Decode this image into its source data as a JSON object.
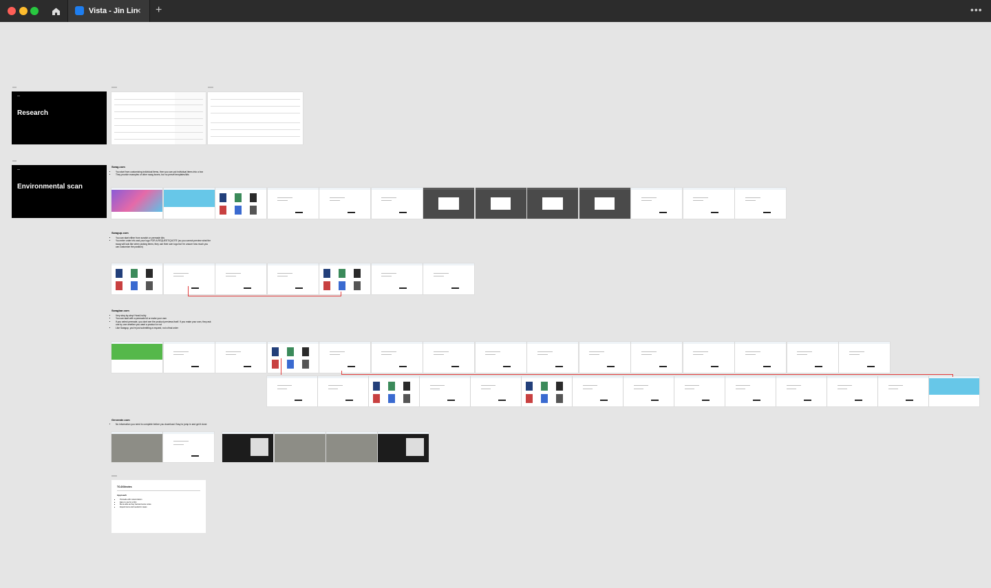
{
  "window": {
    "tab_title": "Vista - Jin Lin",
    "tab_close": "×",
    "new_tab": "+",
    "more": "•••",
    "traffic_lights": {
      "close": "#ff5f57",
      "minimize": "#febc2e",
      "zoom": "#28c840"
    },
    "accent": "#1e7ef0"
  },
  "canvas": {
    "background": "#e5e5e5",
    "sections": [
      {
        "label": "Research"
      },
      {
        "label": "Environmental scan"
      }
    ],
    "swag": {
      "heading": "Swag.com",
      "notes": [
        "You start from customizing individual items, then you can put individual items into a box",
        "They provide examples of other swag boxes, but no preset templates/kits"
      ]
    },
    "swagup": {
      "heading": "Swagup.com",
      "notes": [
        "You can start either from scratch or premade kits",
        "You enter order info and your logo FOR A REQUEST/QUOTE (so you cannot preview what the swag will look like when picking items; they use their own logo but i'm unsure how much you can customize the position)"
      ]
    },
    "swagbar": {
      "heading": "Swagbar.com",
      "notes": [
        "Very step-by-step/ Hand-holdy",
        "You can start with a premade kit or make your own",
        "If you select premade, you dont see the product previews itself. If you make your own, they ask one by one whether you want a product or not",
        "Like Swagup, you're just submitting a request, not a final order"
      ]
    },
    "generate": {
      "heading": "Generate.com",
      "notes": [
        "No information you need to complete before you download. Easy to jump in and get it done"
      ]
    },
    "summary": {
      "title": "TO-DO/notes",
      "subtitle": "Approach",
      "items": [
        "Premade with customization",
        "Easy to use for a first",
        "Be as able as they had and some notes",
        "Expect items and needed in cases"
      ]
    },
    "annotation_color": "#e23b3b"
  }
}
